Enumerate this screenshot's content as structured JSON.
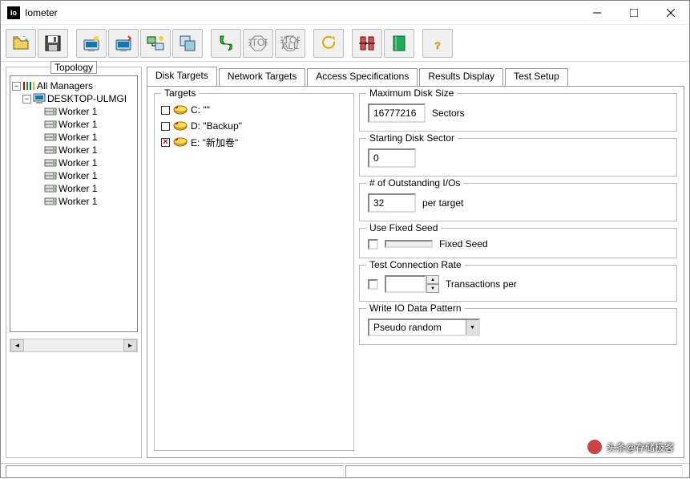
{
  "window": {
    "title": "Iometer"
  },
  "toolbar_icons": [
    "open",
    "save",
    "disk-a",
    "disk-b",
    "split",
    "copy",
    "flag-green",
    "stop",
    "stop-all",
    "undo",
    "align",
    "book",
    "help"
  ],
  "topology": {
    "legend": "Topology",
    "root": "All Managers",
    "host": "DESKTOP-ULMGI",
    "workers": [
      "Worker 1",
      "Worker 1",
      "Worker 1",
      "Worker 1",
      "Worker 1",
      "Worker 1",
      "Worker 1",
      "Worker 1"
    ]
  },
  "tabs": [
    "Disk Targets",
    "Network Targets",
    "Access Specifications",
    "Results Display",
    "Test Setup"
  ],
  "active_tab": 0,
  "targets": {
    "legend": "Targets",
    "disks": [
      {
        "checked": false,
        "label": "C: \"\""
      },
      {
        "checked": false,
        "label": "D: \"Backup\""
      },
      {
        "checked": true,
        "label": "E: \"新加卷\""
      }
    ]
  },
  "settings": {
    "max_disk": {
      "legend": "Maximum Disk Size",
      "value": "16777216",
      "unit": "Sectors"
    },
    "start_sector": {
      "legend": "Starting Disk Sector",
      "value": "0"
    },
    "outstanding": {
      "legend": "# of Outstanding I/Os",
      "value": "32",
      "unit": "per target"
    },
    "fixed_seed": {
      "legend": "Use Fixed Seed",
      "label": "Fixed Seed"
    },
    "conn_rate": {
      "legend": "Test Connection Rate",
      "label": "Transactions per"
    },
    "pattern": {
      "legend": "Write IO Data Pattern",
      "value": "Pseudo random"
    }
  },
  "watermark": "头条@存储极客"
}
